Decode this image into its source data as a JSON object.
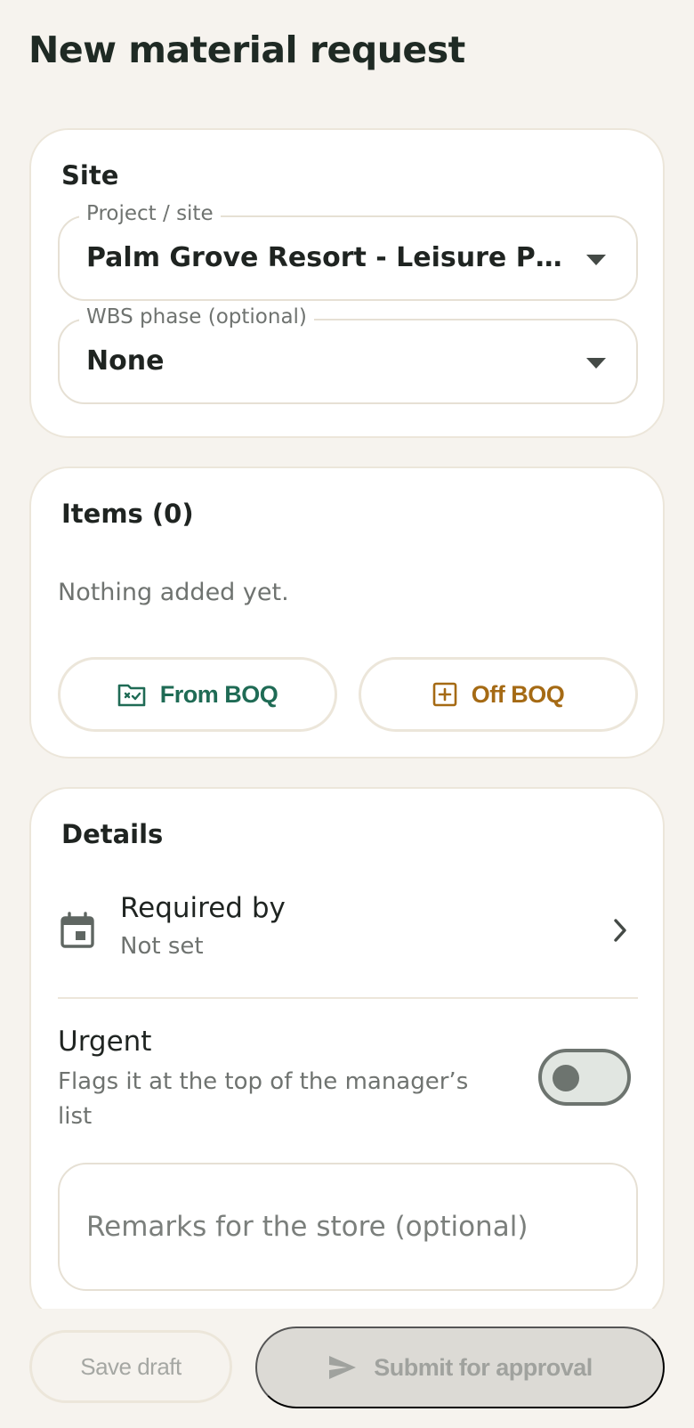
{
  "header": {
    "title": "New material request"
  },
  "site": {
    "title": "Site",
    "project": {
      "label": "Project / site",
      "value": "Palm Grove Resort - Leisure Pool Complex"
    },
    "wbs": {
      "label": "WBS phase (optional)",
      "value": "None"
    }
  },
  "items": {
    "title": "Items (0)",
    "empty_text": "Nothing added yet.",
    "from_boq_label": "From BOQ",
    "off_boq_label": "Off BOQ"
  },
  "details": {
    "title": "Details",
    "required_by": {
      "label": "Required by",
      "value": "Not set"
    },
    "urgent": {
      "label": "Urgent",
      "description": "Flags it at the top of the manager’s list",
      "on": false
    },
    "remarks_placeholder": "Remarks for the store (optional)"
  },
  "actions": {
    "save_draft_label": "Save draft",
    "submit_label": "Submit for approval"
  },
  "colors": {
    "accent_green": "#1f6b55",
    "accent_amber": "#a56a14",
    "background": "#f6f3ee"
  }
}
